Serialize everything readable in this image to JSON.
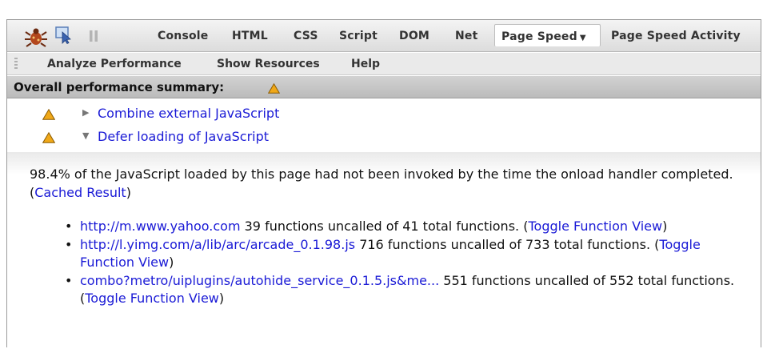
{
  "toolbar": {
    "icons": {
      "bug": "firebug-icon",
      "inspect": "inspect-icon",
      "pause": "pause-icon"
    },
    "tabs": {
      "console": "Console",
      "html": "HTML",
      "css": "CSS",
      "script": "Script",
      "dom": "DOM",
      "net": "Net",
      "page_speed": "Page Speed",
      "page_speed_activity": "Page Speed Activity"
    },
    "active_tab_caret": "▼"
  },
  "subbar": {
    "analyze": "Analyze Performance",
    "resources": "Show Resources",
    "help": "Help"
  },
  "summary": {
    "title": "Overall performance summary:",
    "status_icon": "warning-triangle-icon"
  },
  "rules": [
    {
      "label": "Combine external JavaScript",
      "expanded": false,
      "arrow": "▶",
      "status_icon": "warning-triangle-icon"
    },
    {
      "label": "Defer loading of JavaScript",
      "expanded": true,
      "arrow": "▼",
      "status_icon": "warning-triangle-icon"
    }
  ],
  "details": {
    "description": "98.4% of the JavaScript loaded by this page had not been invoked by the time the onload handler completed.",
    "open_paren": "(",
    "cached_result": "Cached Result",
    "close_paren": ")",
    "bullet": "•",
    "items": [
      {
        "url": "http://m.www.yahoo.com",
        "text": "39 functions uncalled of 41 total functions.",
        "toggle": "Toggle Function View"
      },
      {
        "url": "http://l.yimg.com/a/lib/arc/arcade_0.1.98.js",
        "text": "716 functions uncalled of 733 total functions.",
        "toggle": "Toggle Function View"
      },
      {
        "url": "combo?metro/uiplugins/autohide_service_0.1.5.js&me...",
        "text": "551 functions uncalled of 552 total functions.",
        "toggle": "Toggle Function View"
      }
    ]
  },
  "colors": {
    "link": "#1a1ad6",
    "warning_fill": "#f0a818",
    "warning_stroke": "#8a5a00"
  }
}
